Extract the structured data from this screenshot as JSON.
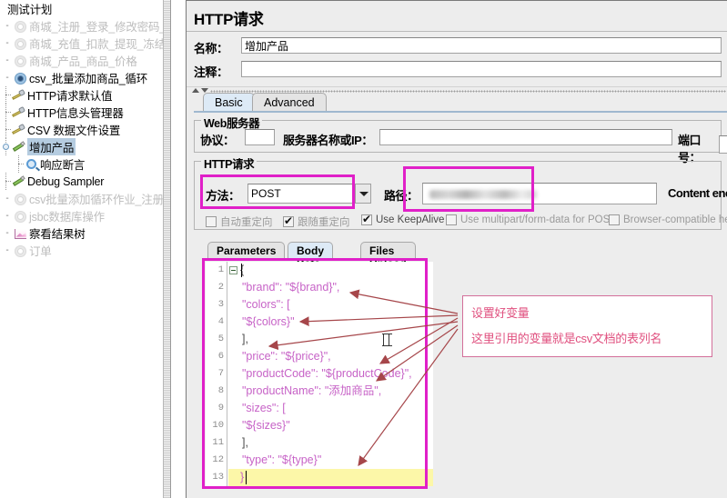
{
  "tree": {
    "root_label": "测试计划",
    "items": [
      {
        "label": "商城_注册_登录_修改密码_冻",
        "icon": "gear-icon",
        "dim": true,
        "indent": 0,
        "twisty": "-"
      },
      {
        "label": "商城_充值_扣款_提现_冻结_解",
        "icon": "gear-icon",
        "dim": true,
        "indent": 0,
        "twisty": "-"
      },
      {
        "label": "商城_产品_商品_价格",
        "icon": "gear-icon",
        "dim": true,
        "indent": 0,
        "twisty": "-"
      },
      {
        "label": "csv_批量添加商品_循环",
        "icon": "gear-icon-blue",
        "dim": false,
        "indent": 0,
        "twisty": "-"
      },
      {
        "label": "HTTP请求默认值",
        "icon": "wrench-icon",
        "dim": false,
        "indent": 1,
        "twisty": ""
      },
      {
        "label": "HTTP信息头管理器",
        "icon": "wrench-icon",
        "dim": false,
        "indent": 1,
        "twisty": ""
      },
      {
        "label": "CSV 数据文件设置",
        "icon": "wrench-icon",
        "dim": false,
        "indent": 1,
        "twisty": ""
      },
      {
        "label": "增加产品",
        "icon": "pencil-icon",
        "dim": false,
        "indent": 1,
        "twisty": "o",
        "selected": true
      },
      {
        "label": "响应断言",
        "icon": "magnifier-icon",
        "dim": false,
        "indent": 2,
        "twisty": ""
      },
      {
        "label": "Debug Sampler",
        "icon": "pencil-icon",
        "dim": false,
        "indent": 1,
        "twisty": ""
      },
      {
        "label": "csv批量添加循环作业_注册_登",
        "icon": "gear-icon",
        "dim": true,
        "indent": 0,
        "twisty": "-"
      },
      {
        "label": "jsbc数据库操作",
        "icon": "gear-icon",
        "dim": true,
        "indent": 0,
        "twisty": "-"
      },
      {
        "label": "察看结果树",
        "icon": "chart-icon",
        "dim": false,
        "indent": 0,
        "twisty": "-"
      },
      {
        "label": "订单",
        "icon": "gear-icon",
        "dim": true,
        "indent": 0,
        "twisty": "-"
      }
    ]
  },
  "panel": {
    "title": "HTTP请求",
    "name_label": "名称：",
    "name_value": "增加产品",
    "comment_label": "注释：",
    "comment_value": ""
  },
  "tabs": [
    {
      "label": "Basic",
      "active": true
    },
    {
      "label": "Advanced",
      "active": false
    }
  ],
  "web_server": {
    "group_title": "Web服务器",
    "protocol_label": "协议：",
    "protocol_value": "",
    "server_label": "服务器名称或IP：",
    "server_value": "",
    "port_label": "端口号：",
    "port_value": ""
  },
  "http_request": {
    "group_title": "HTTP请求",
    "method_label": "方法：",
    "method_value": "POST",
    "path_label": "路径：",
    "path_value": "",
    "content_encoding_label": "Content enco"
  },
  "checkboxes": [
    {
      "label": "自动重定向",
      "checked": false
    },
    {
      "label": "跟随重定向",
      "checked": true
    },
    {
      "label": "Use KeepAlive",
      "checked": true
    },
    {
      "label": "Use multipart/form-data for POST",
      "checked": false
    },
    {
      "label": "Browser-compatible he",
      "checked": false
    }
  ],
  "inner_tabs": [
    {
      "label": "Parameters",
      "active": false
    },
    {
      "label": "Body Data",
      "active": true
    },
    {
      "label": "Files Upload",
      "active": false
    }
  ],
  "editor": {
    "lines": [
      {
        "num": "1",
        "text": "{",
        "plain": true
      },
      {
        "num": "2",
        "text": "\"brand\": \"${brand}\",",
        "plain": false
      },
      {
        "num": "3",
        "text": "\"colors\": [",
        "plain": false
      },
      {
        "num": "4",
        "text": "\"${colors}\"",
        "plain": false
      },
      {
        "num": "5",
        "text": "],",
        "plain": true
      },
      {
        "num": "6",
        "text": "\"price\": \"${price}\",",
        "plain": false
      },
      {
        "num": "7",
        "text": "\"productCode\": \"${productCode}\",",
        "plain": false
      },
      {
        "num": "8",
        "text": "\"productName\": \"添加商品\",",
        "plain": false
      },
      {
        "num": "9",
        "text": "\"sizes\": [",
        "plain": false
      },
      {
        "num": "10",
        "text": "\"${sizes}\"",
        "plain": false
      },
      {
        "num": "11",
        "text": "],",
        "plain": true
      },
      {
        "num": "12",
        "text": "\"type\": \"${type}\"",
        "plain": false
      },
      {
        "num": "13",
        "text": "}",
        "plain": true
      }
    ]
  },
  "annotation": {
    "line1": "设置好变量",
    "line2": "这里引用的变量就是csv文档的表列名"
  },
  "colors": {
    "highlight": "#e020c8",
    "annotation_text": "#e0507f",
    "annotation_border": "#d36f9a",
    "arrow": "#a6464a",
    "code_string": "#c763c7",
    "selection": "#b5cce0",
    "current_line": "#fcf7a8"
  }
}
